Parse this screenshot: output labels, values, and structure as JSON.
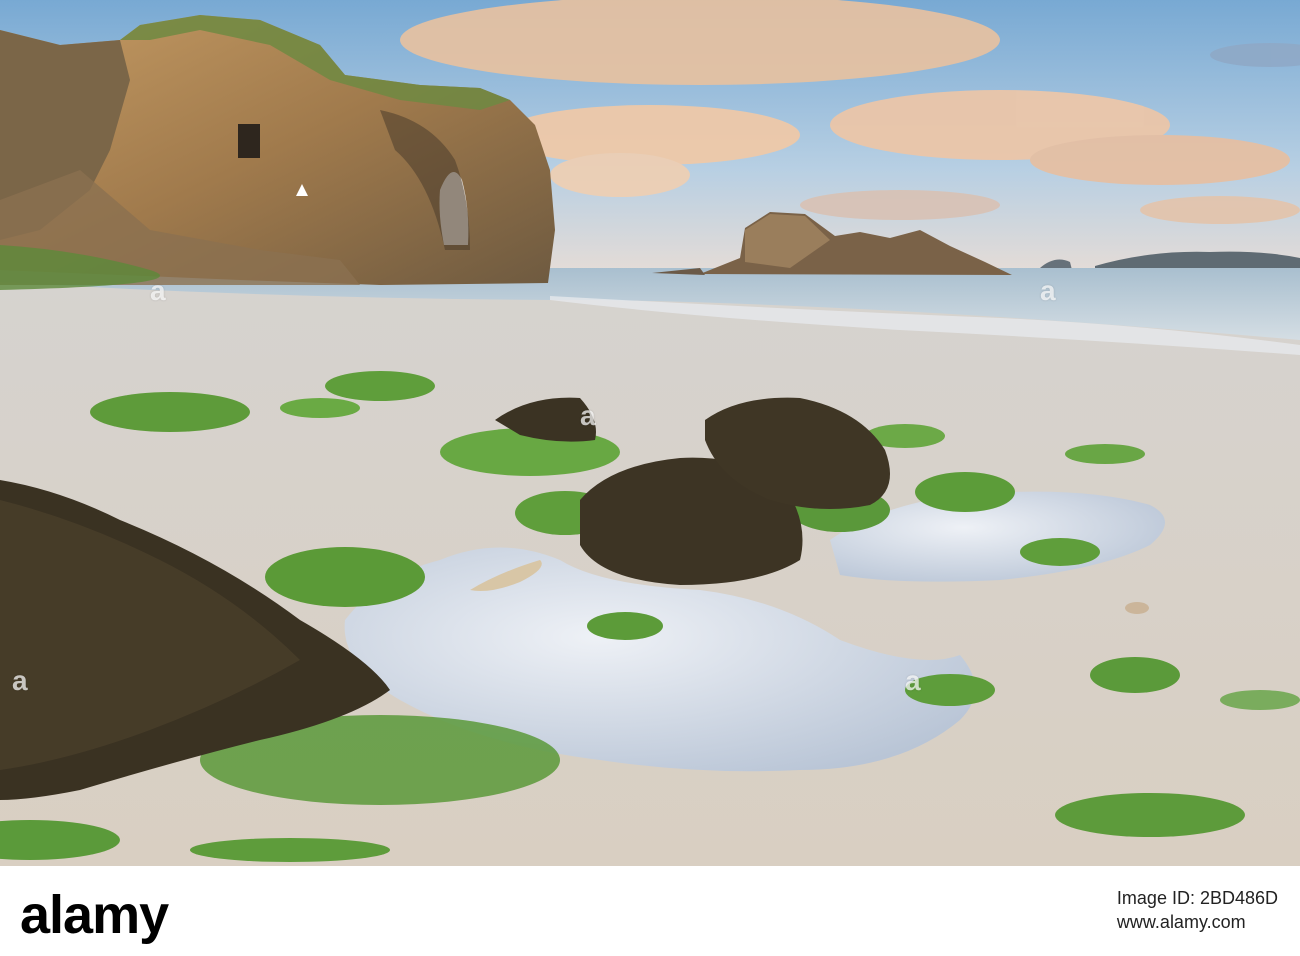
{
  "watermark": {
    "text": "a"
  },
  "footer": {
    "logo_text": "alamy",
    "image_id_label": "Image ID: 2BD486D",
    "site_url": "www.alamy.com"
  },
  "colors": {
    "sky_top": "#7fb0d8",
    "sky_low": "#d9e3ea",
    "cloud": "#f2c7a3",
    "sea": "#b7c9d6",
    "sand": "#d8d2c8",
    "cliff": "#b08a5a",
    "algae": "#5aa33b",
    "seaweed": "#3b3322"
  }
}
